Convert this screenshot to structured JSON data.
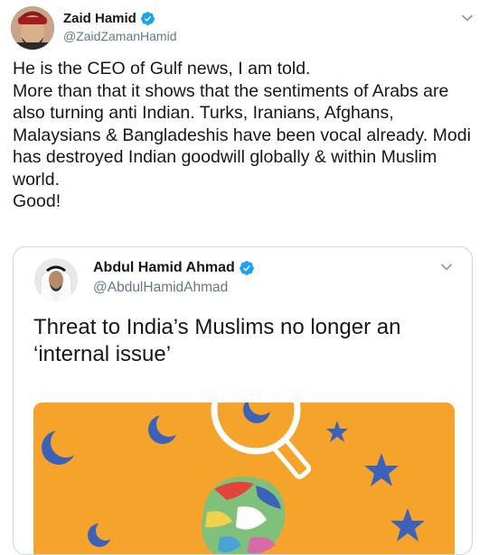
{
  "tweet": {
    "author_name": "Zaid Hamid",
    "author_handle": "@ZaidZamanHamid",
    "text": "He is the CEO of Gulf news, I am told.\nMore than that it shows that the sentiments of Arabs are also turning anti Indian. Turks, Iranians, Afghans, Malaysians & Bangladeshis have been vocal already. Modi has destroyed Indian goodwill globally & within Muslim world.\nGood!"
  },
  "quoted_tweet": {
    "author_name": "Abdul Hamid Ahmad",
    "author_handle": "@AbdulHamidAhmad",
    "text": "Threat to India’s Muslims no longer an\n‘internal issue’"
  },
  "icons": {
    "verified": "verified-badge-icon",
    "menu": "chevron-down-icon"
  },
  "colors": {
    "verified_blue": "#1da1f2",
    "handle_gray": "#657786",
    "border": "#ccd6dd",
    "media_orange": "#f6a32b",
    "media_blue": "#3b62b8"
  }
}
